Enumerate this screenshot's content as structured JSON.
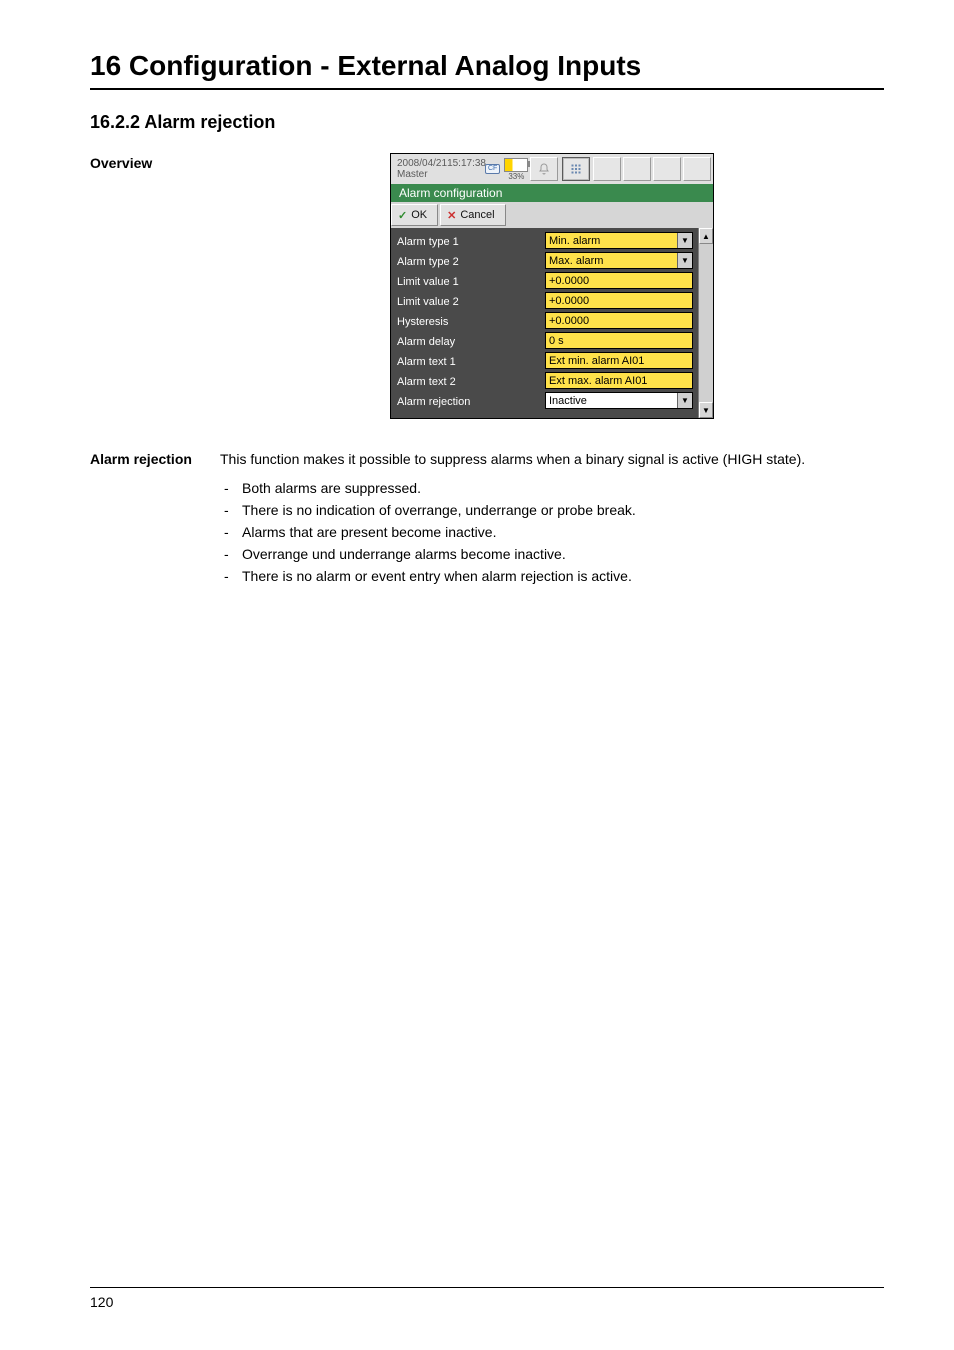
{
  "chapter_title": "16 Configuration - External Analog Inputs",
  "section_title": "16.2.2 Alarm rejection",
  "overview_label": "Overview",
  "screenshot": {
    "sys_date": "2008/04/21",
    "sys_time": "15:17:38",
    "sys_master": "Master",
    "cf_label": "CF",
    "battery_pct": "33%",
    "titlebar": "Alarm configuration",
    "btn_ok": "OK",
    "btn_cancel": "Cancel",
    "rows": [
      {
        "label": "Alarm type 1",
        "value": "Min. alarm",
        "kind": "select"
      },
      {
        "label": "Alarm type 2",
        "value": "Max. alarm",
        "kind": "select"
      },
      {
        "label": "Limit value 1",
        "value": "+0.0000",
        "kind": "yellow"
      },
      {
        "label": "Limit value 2",
        "value": "+0.0000",
        "kind": "yellow"
      },
      {
        "label": "Hysteresis",
        "value": "+0.0000",
        "kind": "yellow"
      },
      {
        "label": "Alarm delay",
        "value": "0 s",
        "kind": "yellow"
      },
      {
        "label": "Alarm text 1",
        "value": "Ext min. alarm AI01",
        "kind": "yellow"
      },
      {
        "label": "Alarm text 2",
        "value": "Ext max. alarm AI01",
        "kind": "yellow"
      },
      {
        "label": "Alarm rejection",
        "value": "Inactive",
        "kind": "white_select"
      }
    ]
  },
  "paragraph_label": "Alarm rejection",
  "paragraph_text": "This function makes it possible to suppress alarms when a binary signal is active (HIGH state).",
  "bullets": [
    "Both alarms are suppressed.",
    "There is no indication of overrange, underrange or probe break.",
    "Alarms that are present become inactive.",
    "Overrange und underrange alarms become inactive.",
    "There is no alarm or event entry when alarm rejection is active."
  ],
  "page_number": "120"
}
